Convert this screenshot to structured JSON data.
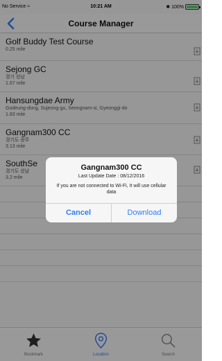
{
  "status_bar": {
    "carrier": "No Service",
    "time": "10:21 AM",
    "battery": "100%"
  },
  "nav": {
    "title": "Course Manager"
  },
  "courses": [
    {
      "name": "Golf Buddy Test Course",
      "address": "",
      "distance": "0.25 mile"
    },
    {
      "name": "Sejong GC",
      "address": "경기 성남",
      "distance": "1.67 mile"
    },
    {
      "name": "Hansungdae Army",
      "address": "Godeung-dong, Sujeong-gu, Seongnam-si, Gyeonggi-do",
      "distance": "1.83 mile"
    },
    {
      "name": "Gangnam300 CC",
      "address": "경기도 광주",
      "distance": "3.13 mile"
    },
    {
      "name": "SouthSe",
      "address": "경기도 성남",
      "distance": "3.2 mile"
    }
  ],
  "alert": {
    "title": "Gangnam300 CC",
    "subtitle": "Last Update Date : 08/12/2016",
    "message": "If you are not connected to Wi-Fi, It will use cellular data",
    "cancel_label": "Cancel",
    "confirm_label": "Download"
  },
  "tabs": [
    {
      "label": "Bookmark",
      "icon": "star-icon"
    },
    {
      "label": "Location",
      "icon": "location-pin-icon"
    },
    {
      "label": "Search",
      "icon": "search-icon"
    }
  ],
  "colors": {
    "accent": "#2f7cf6",
    "battery": "#4cd964"
  }
}
